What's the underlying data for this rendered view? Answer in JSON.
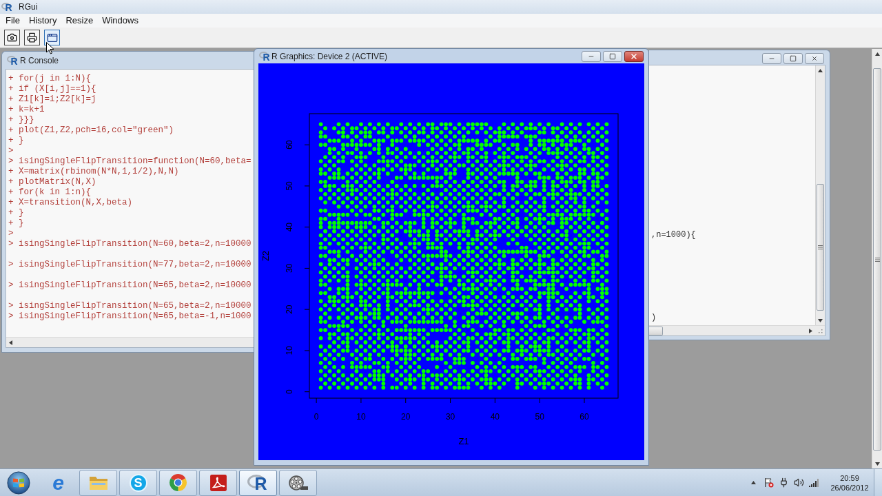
{
  "app": {
    "logo": "R",
    "title": "RGui"
  },
  "menu": [
    "File",
    "History",
    "Resize",
    "Windows"
  ],
  "toolbar": [
    {
      "kind": "camera",
      "hovered": false
    },
    {
      "kind": "printer",
      "hovered": false
    },
    {
      "kind": "window",
      "hovered": true
    }
  ],
  "console": {
    "logo": "R",
    "title": "R Console",
    "blocks": [
      [
        "+ for(j in 1:N){",
        "+ if (X[i,j]==1){",
        "+ Z1[k]=i;Z2[k]=j",
        "+ k=k+1",
        "+ }}}",
        "+ plot(Z1,Z2,pch=16,col=\"green\")",
        "+ }",
        ">",
        "> isingSingleFlipTransition=function(N=60,beta=",
        "+ X=matrix(rbinom(N*N,1,1/2),N,N)",
        "+ plotMatrix(N,X)",
        "+ for(k in 1:n){",
        "+ X=transition(N,X,beta)",
        "+ }",
        "+ }",
        ">",
        "> isingSingleFlipTransition(N=60,beta=2,n=10000"
      ],
      [
        "> isingSingleFlipTransition(N=77,beta=2,n=10000"
      ],
      [
        "> isingSingleFlipTransition(N=65,beta=2,n=10000"
      ],
      [
        "> isingSingleFlipTransition(N=65,beta=2,n=10000",
        "> isingSingleFlipTransition(N=65,beta=-1,n=1000"
      ]
    ]
  },
  "graphics": {
    "logo": "R",
    "title": "R Graphics: Device 2 (ACTIVE)",
    "chart_data": [
      {
        "type": "scatter",
        "xlabel": "Z1",
        "ylabel": "Z2",
        "xticks": [
          0,
          10,
          20,
          30,
          40,
          50,
          60
        ],
        "yticks": [
          0,
          10,
          20,
          30,
          40,
          50,
          60
        ],
        "xlim": [
          -1.56,
          67.56
        ],
        "ylim": [
          -1.56,
          67.56
        ],
        "marker": "circle",
        "color": "#00ff00"
      }
    ]
  },
  "editor": {
    "lines": [
      ",n=1000){",
      ")"
    ]
  },
  "taskbar": {
    "items": [
      {
        "kind": "browser-e",
        "label": "e",
        "running": false,
        "selected": false
      },
      {
        "kind": "folder",
        "running": true,
        "selected": false
      },
      {
        "kind": "chat-s",
        "label": "S",
        "running": true,
        "selected": false
      },
      {
        "kind": "browser-ball",
        "running": true,
        "selected": false
      },
      {
        "kind": "pdf",
        "running": true,
        "selected": false
      },
      {
        "kind": "r",
        "label": "R",
        "running": true,
        "selected": true
      },
      {
        "kind": "film-reel",
        "running": true,
        "selected": false
      }
    ],
    "clock": {
      "time": "20:59",
      "date": "26/06/2012"
    }
  }
}
